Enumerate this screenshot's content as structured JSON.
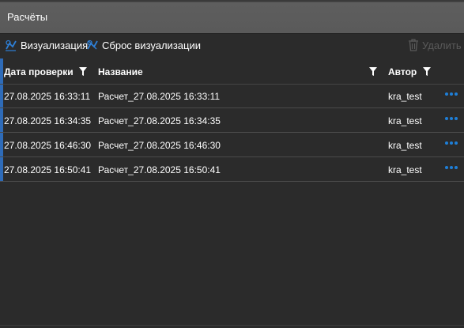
{
  "window": {
    "title": "Расчёты"
  },
  "toolbar": {
    "visualize_label": "Визуализация",
    "reset_label": "Сброс визуализации",
    "delete_label": "Удалить"
  },
  "table": {
    "columns": [
      "Дата проверки",
      "Название",
      "Автор"
    ],
    "rows": [
      {
        "date": "27.08.2025 16:33:11",
        "name": "Расчет_27.08.2025 16:33:11",
        "author": "kra_test"
      },
      {
        "date": "27.08.2025 16:34:35",
        "name": "Расчет_27.08.2025 16:34:35",
        "author": "kra_test"
      },
      {
        "date": "27.08.2025 16:46:30",
        "name": "Расчет_27.08.2025 16:46:30",
        "author": "kra_test"
      },
      {
        "date": "27.08.2025 16:50:41",
        "name": "Расчет_27.08.2025 16:50:41",
        "author": "kra_test"
      }
    ]
  },
  "colors": {
    "accent": "#2e6bb8",
    "more_icon": "#1e7fd8",
    "disabled": "#5a5a5a"
  }
}
